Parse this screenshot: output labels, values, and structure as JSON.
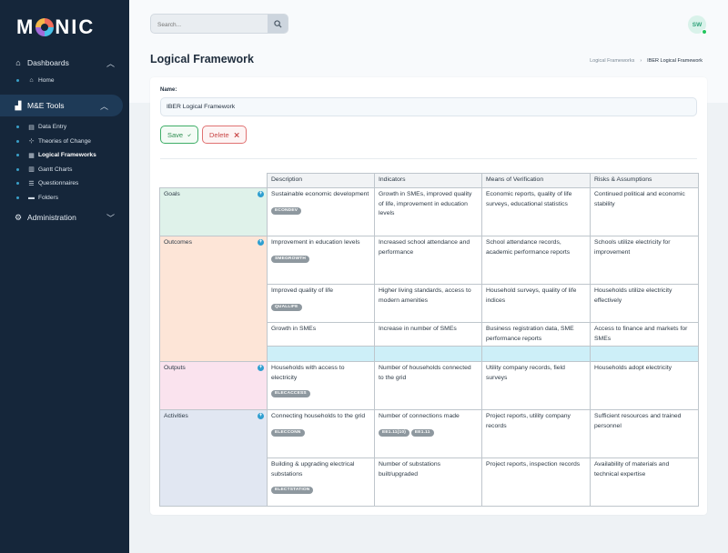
{
  "app": {
    "logo": "M  NIC"
  },
  "sidebar": {
    "groups": [
      {
        "label": "Dashboards",
        "icon": "home-icon",
        "items": [
          {
            "label": "Home",
            "icon": "home-icon"
          }
        ]
      },
      {
        "label": "M&E Tools",
        "icon": "chart-icon",
        "active": true,
        "items": [
          {
            "label": "Data Entry",
            "icon": "table-icon"
          },
          {
            "label": "Theories of Change",
            "icon": "sitemap-icon"
          },
          {
            "label": "Logical Frameworks",
            "icon": "grid-icon",
            "current": true
          },
          {
            "label": "Gantt Charts",
            "icon": "gantt-icon"
          },
          {
            "label": "Questionnaires",
            "icon": "list-icon"
          },
          {
            "label": "Folders",
            "icon": "folder-icon"
          }
        ]
      },
      {
        "label": "Administration",
        "icon": "gears-icon",
        "items": []
      }
    ]
  },
  "topbar": {
    "search_placeholder": "Search...",
    "avatar_initials": "SW"
  },
  "page": {
    "title": "Logical Framework",
    "breadcrumb": [
      "Logical Frameworks",
      "IBER Logical Framework"
    ]
  },
  "form": {
    "name_label": "Name:",
    "name_value": "IBER Logical Framework",
    "save_label": "Save",
    "delete_label": "Delete"
  },
  "framework": {
    "headers": [
      "Description",
      "Indicators",
      "Means of Verification",
      "Risks & Assumptions"
    ],
    "levels": {
      "goals": "Goals",
      "outcomes": "Outcomes",
      "outputs": "Outputs",
      "activities": "Activities"
    },
    "goals": [
      {
        "desc": "Sustainable economic development",
        "code": "ECONDEV",
        "ind": "Growth in SMEs, improved quality of life, improvement in education levels",
        "mov": "Economic reports, quality of life surveys, educational statistics",
        "risk": "Continued political and economic stability"
      }
    ],
    "outcomes": [
      {
        "desc": "Improvement in education levels",
        "code": "SMEGROWTH",
        "ind": "Increased school attendance and performance",
        "mov": "School attendance records, academic performance reports",
        "risk": "Schools utilize electricity for improvement"
      },
      {
        "desc": "Improved quality of life",
        "code": "QUALLIFE",
        "ind": "Higher living standards, access to modern amenities",
        "mov": "Household surveys, quality of life indices",
        "risk": "Households utilize electricity effectively"
      },
      {
        "desc": "Growth in SMEs",
        "code": "",
        "ind": "Increase in number of SMEs",
        "mov": "Business registration data, SME performance reports",
        "risk": "Access to finance and markets for SMEs"
      }
    ],
    "outputs": [
      {
        "desc": "Households with access to electricity",
        "code": "ELECACCESS",
        "ind": "Number of households connected to the grid",
        "mov": "Utility company records, field surveys",
        "risk": "Households adopt electricity"
      }
    ],
    "activities": [
      {
        "desc": "Connecting households to the grid",
        "code": "ELECCONN",
        "ind": "Number of connections made",
        "ind_codes": [
          "EE1.11(10)",
          "EE1.11"
        ],
        "mov": "Project reports, utility company records",
        "risk": "Sufficient resources and trained personnel"
      },
      {
        "desc": "Building & upgrading electrical substations",
        "code": "ELECTSTATION",
        "ind": "Number of substations built/upgraded",
        "mov": "Project reports, inspection records",
        "risk": "Availability of materials and technical expertise"
      }
    ]
  },
  "colors": {
    "sidebar": "#15263a",
    "goals": "#dff2ea",
    "outcomes": "#fde5d7",
    "outputs": "#fae3ee",
    "activities": "#e1e7f2",
    "highlight_row": "#cdeff8"
  }
}
